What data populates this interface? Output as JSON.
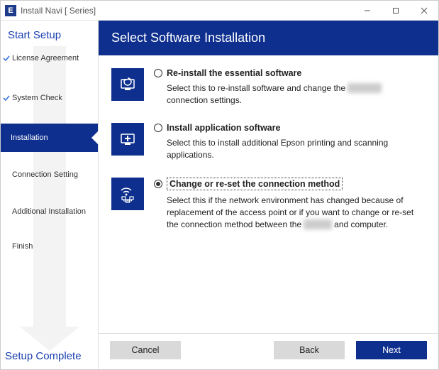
{
  "titlebar": {
    "logo_letter": "E",
    "title": "Install Navi [        Series]"
  },
  "sidebar": {
    "start_label": "Start Setup",
    "complete_label": "Setup Complete",
    "steps": [
      {
        "label": "License Agreement",
        "state": "done"
      },
      {
        "label": "System Check",
        "state": "done"
      },
      {
        "label": "Installation",
        "state": "active"
      },
      {
        "label": "Connection Setting",
        "state": "pending"
      },
      {
        "label": "Additional Installation",
        "state": "pending"
      },
      {
        "label": "Finish",
        "state": "pending"
      }
    ]
  },
  "main": {
    "heading": "Select Software Installation",
    "options": [
      {
        "id": "reinstall",
        "title": "Re-install the essential software",
        "desc_pre": "Select this to re-install software and change the ",
        "desc_blur": "Printer's",
        "desc_post": " connection settings.",
        "selected": false
      },
      {
        "id": "install-apps",
        "title": "Install application software",
        "desc_pre": "Select this to install additional Epson printing and scanning applications.",
        "desc_blur": "",
        "desc_post": "",
        "selected": false
      },
      {
        "id": "change-connection",
        "title": "Change or re-set the connection method",
        "desc_pre": "Select this if the network environment has changed because of replacement of the access point or if you want to change or re-set the connection method between the ",
        "desc_blur": "Printer",
        "desc_post": " and computer.",
        "selected": true
      }
    ]
  },
  "footer": {
    "cancel": "Cancel",
    "back": "Back",
    "next": "Next"
  }
}
